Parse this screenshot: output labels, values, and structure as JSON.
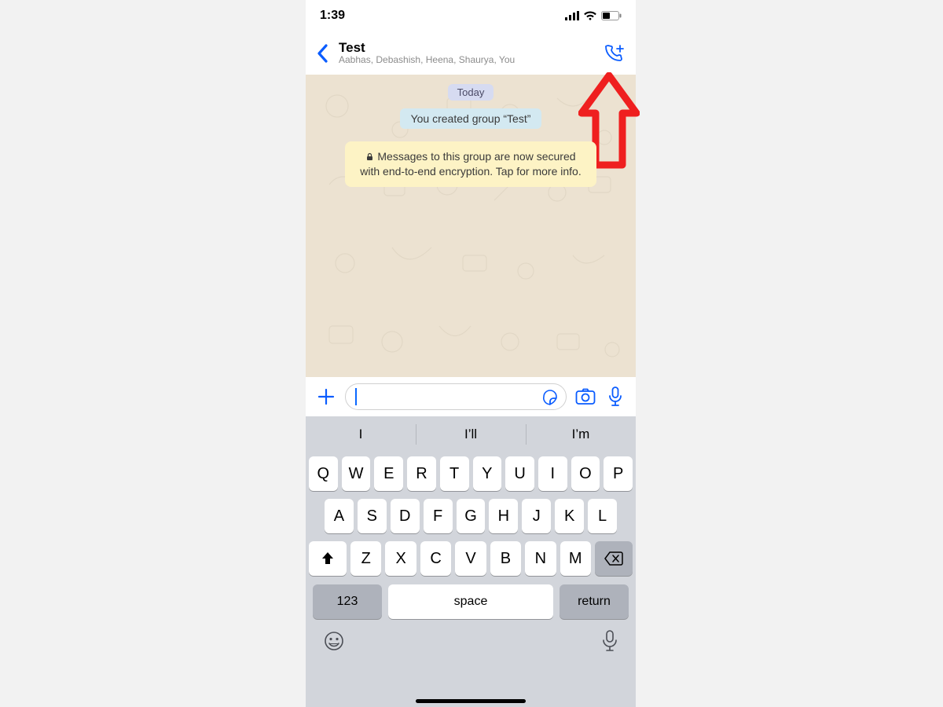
{
  "status": {
    "time": "1:39"
  },
  "nav": {
    "title": "Test",
    "subtitle": "Aabhas, Debashish, Heena, Shaurya, You"
  },
  "chat": {
    "date_pill": "Today",
    "created_pill": "You created group “Test”",
    "encryption_notice": "Messages to this group are now secured with end-to-end encryption. Tap for more info."
  },
  "keyboard": {
    "suggestions": [
      "I",
      "I’ll",
      "I’m"
    ],
    "row1": [
      "Q",
      "W",
      "E",
      "R",
      "T",
      "Y",
      "U",
      "I",
      "O",
      "P"
    ],
    "row2": [
      "A",
      "S",
      "D",
      "F",
      "G",
      "H",
      "J",
      "K",
      "L"
    ],
    "row3": [
      "Z",
      "X",
      "C",
      "V",
      "B",
      "N",
      "M"
    ],
    "num_label": "123",
    "space_label": "space",
    "return_label": "return"
  }
}
